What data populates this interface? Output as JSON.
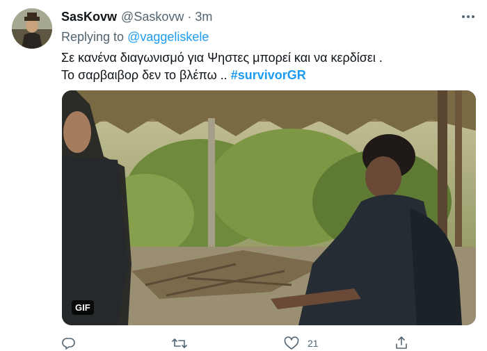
{
  "tweet": {
    "display_name": "SasKovw",
    "handle": "@Saskovw",
    "separator": "·",
    "time": "3m",
    "replying_label": "Replying to",
    "replying_to": "@vaggeliskele",
    "text_line1": "Σε κανένα διαγωνισμό για Ψηστες μπορεί και να κερδίσει .",
    "text_line2": "Το σαρβαιβορ δεν το βλέπω ..",
    "hashtag": "#survivorGR",
    "media_badge": "GIF"
  },
  "actions": {
    "reply_count": "",
    "retweet_count": "",
    "like_count": "21"
  },
  "colors": {
    "link": "#1d9bf0",
    "muted": "#536471",
    "text": "#0f1419"
  },
  "icons": [
    "more-icon",
    "reply-icon",
    "retweet-icon",
    "like-icon",
    "share-icon"
  ]
}
